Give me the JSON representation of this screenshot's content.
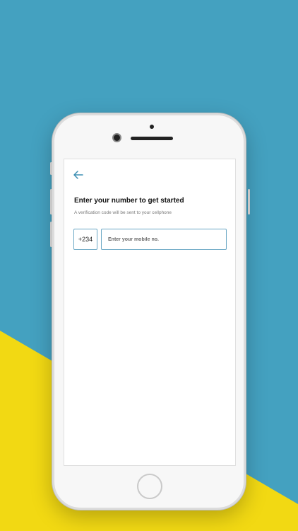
{
  "colors": {
    "background_blue": "#44a1c0",
    "background_yellow": "#f2d913",
    "accent": "#3d8fb3"
  },
  "screen": {
    "back_icon": "arrow-left-icon",
    "title": "Enter your number to get started",
    "subtitle": "A verification code will be sent to your cellphone",
    "country_code": "+234",
    "phone_input": {
      "value": "",
      "placeholder": "Enter your mobile no."
    }
  }
}
